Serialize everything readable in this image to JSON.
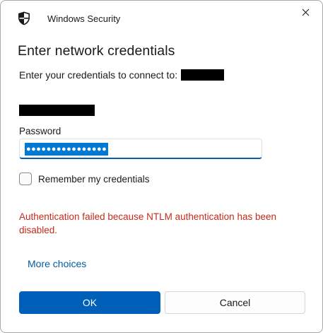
{
  "titlebar": {
    "app_icon": "shield-icon",
    "app_title": "Windows Security",
    "close_icon": "close-icon"
  },
  "main": {
    "heading": "Enter network credentials",
    "instruction": "Enter your credentials to connect to:",
    "password_label": "Password",
    "password_value": "●●●●●●●●●●●●●●●●",
    "remember_label": "Remember my credentials",
    "remember_checked": false,
    "error_message": "Authentication failed because NTLM authentication has been disabled.",
    "more_choices": "More choices"
  },
  "buttons": {
    "ok_label": "OK",
    "cancel_label": "Cancel"
  },
  "colors": {
    "accent": "#005fb8",
    "error": "#c42b1c",
    "link": "#005a9e",
    "selection": "#0078d4"
  }
}
